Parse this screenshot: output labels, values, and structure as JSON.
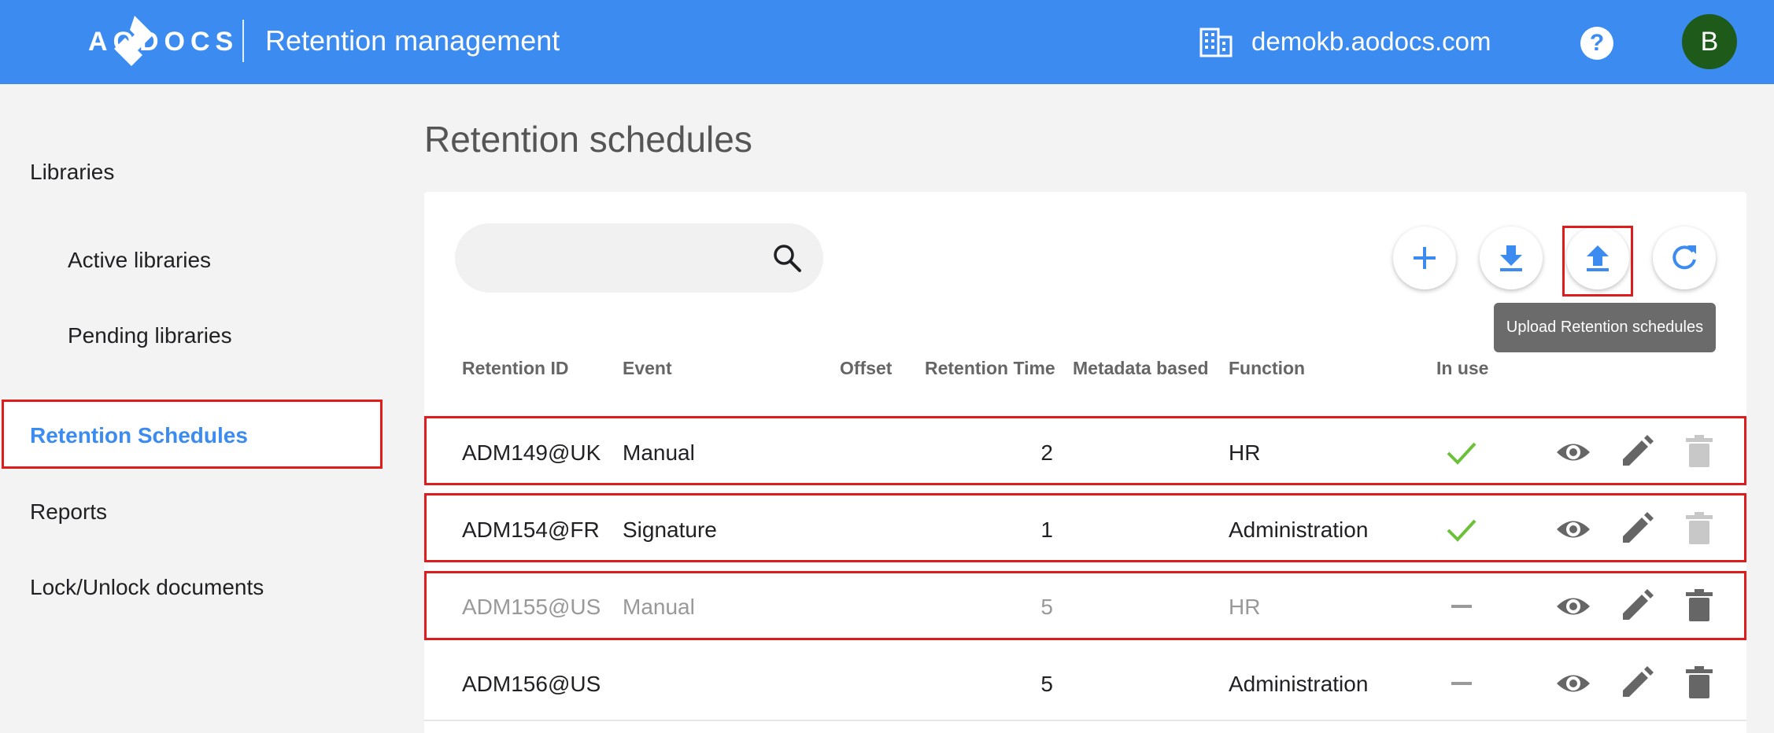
{
  "header": {
    "logo_text": "AODOCS",
    "app_title": "Retention management",
    "domain": "demokb.aodocs.com",
    "avatar_initial": "B",
    "help_label": "?"
  },
  "sidebar": {
    "items": [
      {
        "label": "Libraries",
        "active": false
      },
      {
        "label": "Active libraries",
        "active": false
      },
      {
        "label": "Pending libraries",
        "active": false
      },
      {
        "label": "Retention Schedules",
        "active": true
      },
      {
        "label": "Reports",
        "active": false
      },
      {
        "label": "Lock/Unlock documents",
        "active": false
      }
    ]
  },
  "main": {
    "title": "Retention schedules",
    "search": {
      "placeholder": "",
      "value": ""
    },
    "toolbar": {
      "add_icon": "plus-icon",
      "download_icon": "download-icon",
      "upload_icon": "upload-icon",
      "refresh_icon": "refresh-icon",
      "upload_tooltip": "Upload Retention schedules"
    },
    "table": {
      "columns": [
        "Retention ID",
        "Event",
        "Offset",
        "Retention Time",
        "Metadata based",
        "Function",
        "In use"
      ],
      "rows": [
        {
          "id": "ADM149@UK",
          "event": "Manual",
          "offset": "",
          "time": "2",
          "metadata": "",
          "function": "HR",
          "in_use": true,
          "disabled": false
        },
        {
          "id": "ADM154@FR",
          "event": "Signature",
          "offset": "",
          "time": "1",
          "metadata": "",
          "function": "Administration",
          "in_use": true,
          "disabled": false
        },
        {
          "id": "ADM155@US",
          "event": "Manual",
          "offset": "",
          "time": "5",
          "metadata": "",
          "function": "HR",
          "in_use": false,
          "disabled": true
        },
        {
          "id": "ADM156@US",
          "event": "",
          "offset": "",
          "time": "5",
          "metadata": "",
          "function": "Administration",
          "in_use": false,
          "disabled": false
        }
      ]
    }
  },
  "colors": {
    "header_bg": "#3b8bf0",
    "accent": "#3b8bf0",
    "check_green": "#6cc13a",
    "highlight_red": "#e01b1b",
    "avatar_bg": "#1e5a1a"
  }
}
